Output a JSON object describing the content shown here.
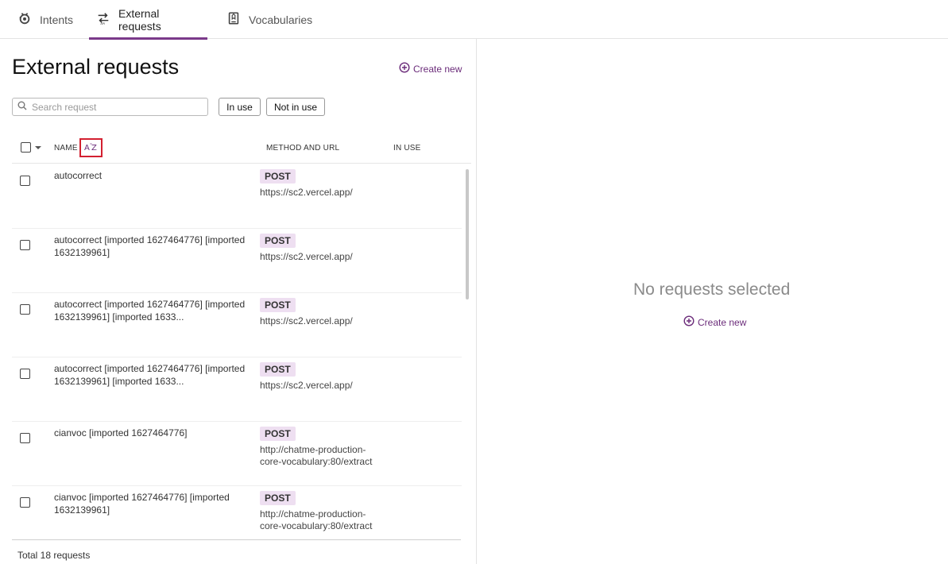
{
  "tabs": [
    {
      "label": "Intents",
      "icon": "intents-gear-icon"
    },
    {
      "label": "External requests",
      "icon": "api-swap-icon"
    },
    {
      "label": "Vocabularies",
      "icon": "vocabulary-book-icon"
    }
  ],
  "accent_color": "#7b3a8a",
  "page_title": "External requests",
  "create_new_label": "Create new",
  "search": {
    "placeholder": "Search request",
    "value": ""
  },
  "filters": {
    "in_use": "In use",
    "not_in_use": "Not in use"
  },
  "columns": {
    "name": "NAME",
    "sort_icon": "A-Z",
    "method_url": "METHOD AND URL",
    "in_use": "IN USE"
  },
  "rows": [
    {
      "name": "autocorrect",
      "method": "POST",
      "url": "https://sc2.vercel.app/"
    },
    {
      "name": "autocorrect [imported 1627464776] [imported 1632139961]",
      "method": "POST",
      "url": "https://sc2.vercel.app/"
    },
    {
      "name": "autocorrect [imported 1627464776] [imported 1632139961] [imported 1633...",
      "method": "POST",
      "url": "https://sc2.vercel.app/"
    },
    {
      "name": "autocorrect [imported 1627464776] [imported 1632139961] [imported 1633...",
      "method": "POST",
      "url": "https://sc2.vercel.app/"
    },
    {
      "name": "cianvoc [imported 1627464776]",
      "method": "POST",
      "url": "http://chatme-production-core-vocabulary:80/extract"
    },
    {
      "name": "cianvoc [imported 1627464776] [imported 1632139961]",
      "method": "POST",
      "url": "http://chatme-production-core-vocabulary:80/extract"
    }
  ],
  "footer": {
    "total": "Total 18 requests"
  },
  "empty_state": {
    "title": "No requests selected",
    "create_label": "Create new"
  }
}
